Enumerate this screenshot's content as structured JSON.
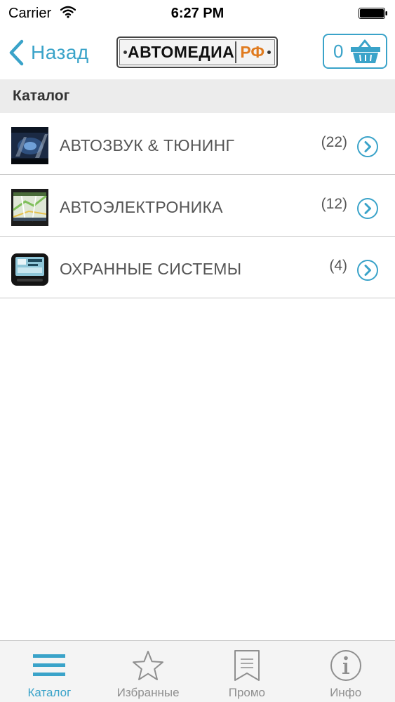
{
  "status_bar": {
    "carrier": "Carrier",
    "time": "6:27 PM"
  },
  "nav": {
    "back_label": "Назад",
    "logo_text": "АВТОМЕДИА",
    "logo_suffix": "РФ",
    "cart_count": "0"
  },
  "section": {
    "title": "Каталог"
  },
  "catalog": {
    "items": [
      {
        "title": "АВТОЗВУК & ТЮНИНГ",
        "count": "(22)",
        "icon": "car-audio-thumbnail"
      },
      {
        "title": "АВТОЭЛЕКТРОНИКА",
        "count": "(12)",
        "icon": "gps-navigator-thumbnail"
      },
      {
        "title": "ОХРАННЫЕ СИСТЕМЫ",
        "count": "(4)",
        "icon": "alarm-remote-thumbnail"
      }
    ]
  },
  "tab_bar": {
    "tabs": [
      {
        "label": "Каталог",
        "icon": "list-icon",
        "active": true
      },
      {
        "label": "Избранные",
        "icon": "star-icon",
        "active": false
      },
      {
        "label": "Промо",
        "icon": "bookmark-icon",
        "active": false
      },
      {
        "label": "Инфо",
        "icon": "info-icon",
        "active": false
      }
    ]
  },
  "colors": {
    "accent": "#3aa3c9",
    "logo_orange": "#e07b1f",
    "section_bg": "#ececec",
    "tab_bar_bg": "#f4f4f4",
    "inactive_tab": "#8f8f8f"
  }
}
